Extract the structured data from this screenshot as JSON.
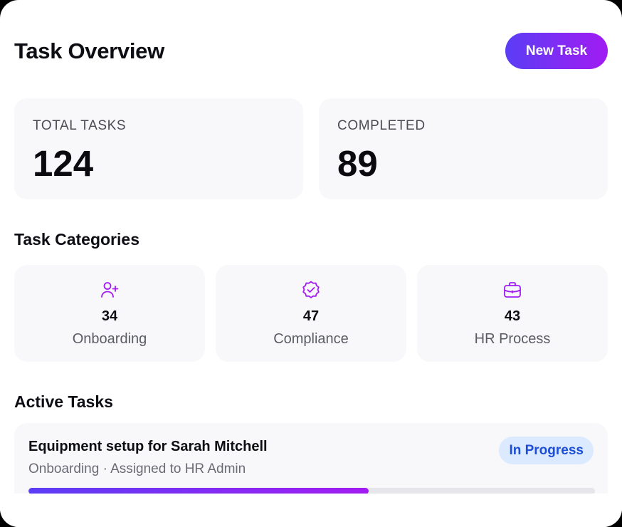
{
  "header": {
    "title": "Task Overview",
    "new_task_label": "New Task"
  },
  "stats": {
    "total_label": "TOTAL TASKS",
    "total_value": "124",
    "completed_label": "COMPLETED",
    "completed_value": "89"
  },
  "categories": {
    "title": "Task Categories",
    "items": [
      {
        "count": "34",
        "label": "Onboarding",
        "icon": "user-plus-icon"
      },
      {
        "count": "47",
        "label": "Compliance",
        "icon": "badge-check-icon"
      },
      {
        "count": "43",
        "label": "HR Process",
        "icon": "briefcase-icon"
      }
    ]
  },
  "active_tasks": {
    "title": "Active Tasks",
    "items": [
      {
        "title": "Equipment setup for Sarah Mitchell",
        "meta": "Onboarding · Assigned to HR Admin",
        "status": "In Progress",
        "progress": 0.6
      }
    ]
  },
  "colors": {
    "accent_start": "#5b3df5",
    "accent_end": "#a21cf2",
    "icon": "#a21cf2",
    "status_bg": "#dbeafe",
    "status_text": "#1d4ed8"
  }
}
